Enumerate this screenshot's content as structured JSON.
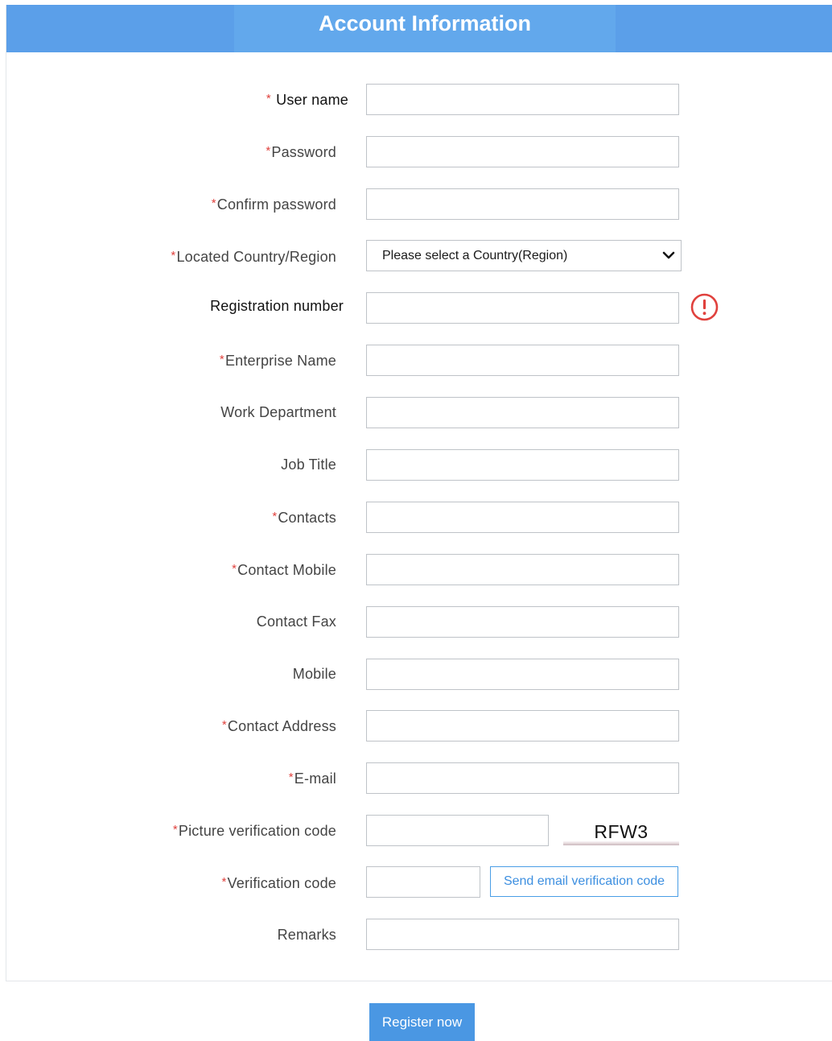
{
  "header": {
    "title": "Account Information"
  },
  "form": {
    "required_marker": "*",
    "fields": {
      "user_name": {
        "label": "User name",
        "value": ""
      },
      "password": {
        "label": "Password",
        "value": ""
      },
      "confirm_password": {
        "label": "Confirm password",
        "value": ""
      },
      "country_region": {
        "label": "Located Country/Region",
        "selected": "Please select a Country(Region)"
      },
      "registration_number": {
        "label": "Registration number",
        "value": ""
      },
      "enterprise_name": {
        "label": "Enterprise Name",
        "value": ""
      },
      "work_department": {
        "label": "Work Department",
        "value": ""
      },
      "job_title": {
        "label": "Job Title",
        "value": ""
      },
      "contacts": {
        "label": "Contacts",
        "value": ""
      },
      "contact_mobile": {
        "label": "Contact Mobile",
        "value": ""
      },
      "contact_fax": {
        "label": "Contact Fax",
        "value": ""
      },
      "mobile": {
        "label": "Mobile",
        "value": ""
      },
      "contact_address": {
        "label": "Contact Address",
        "value": ""
      },
      "email": {
        "label": "E-mail",
        "value": ""
      },
      "picture_code": {
        "label": "Picture verification code",
        "value": "",
        "captcha_text": "RFW3"
      },
      "verification_code": {
        "label": "Verification code",
        "value": "",
        "send_label": "Send email verification code"
      },
      "remarks": {
        "label": "Remarks",
        "value": ""
      }
    },
    "register_label": "Register now"
  },
  "icons": {
    "dropdown": "chevron-down-icon",
    "registration_warning": "exclamation-circle-icon"
  },
  "colors": {
    "header": "#5b9fe9",
    "header_center": "#62a8ec",
    "required": "#e0413d",
    "warning": "#e0413d",
    "link_blue": "#3d8fe0",
    "button_blue": "#4a97e3"
  }
}
